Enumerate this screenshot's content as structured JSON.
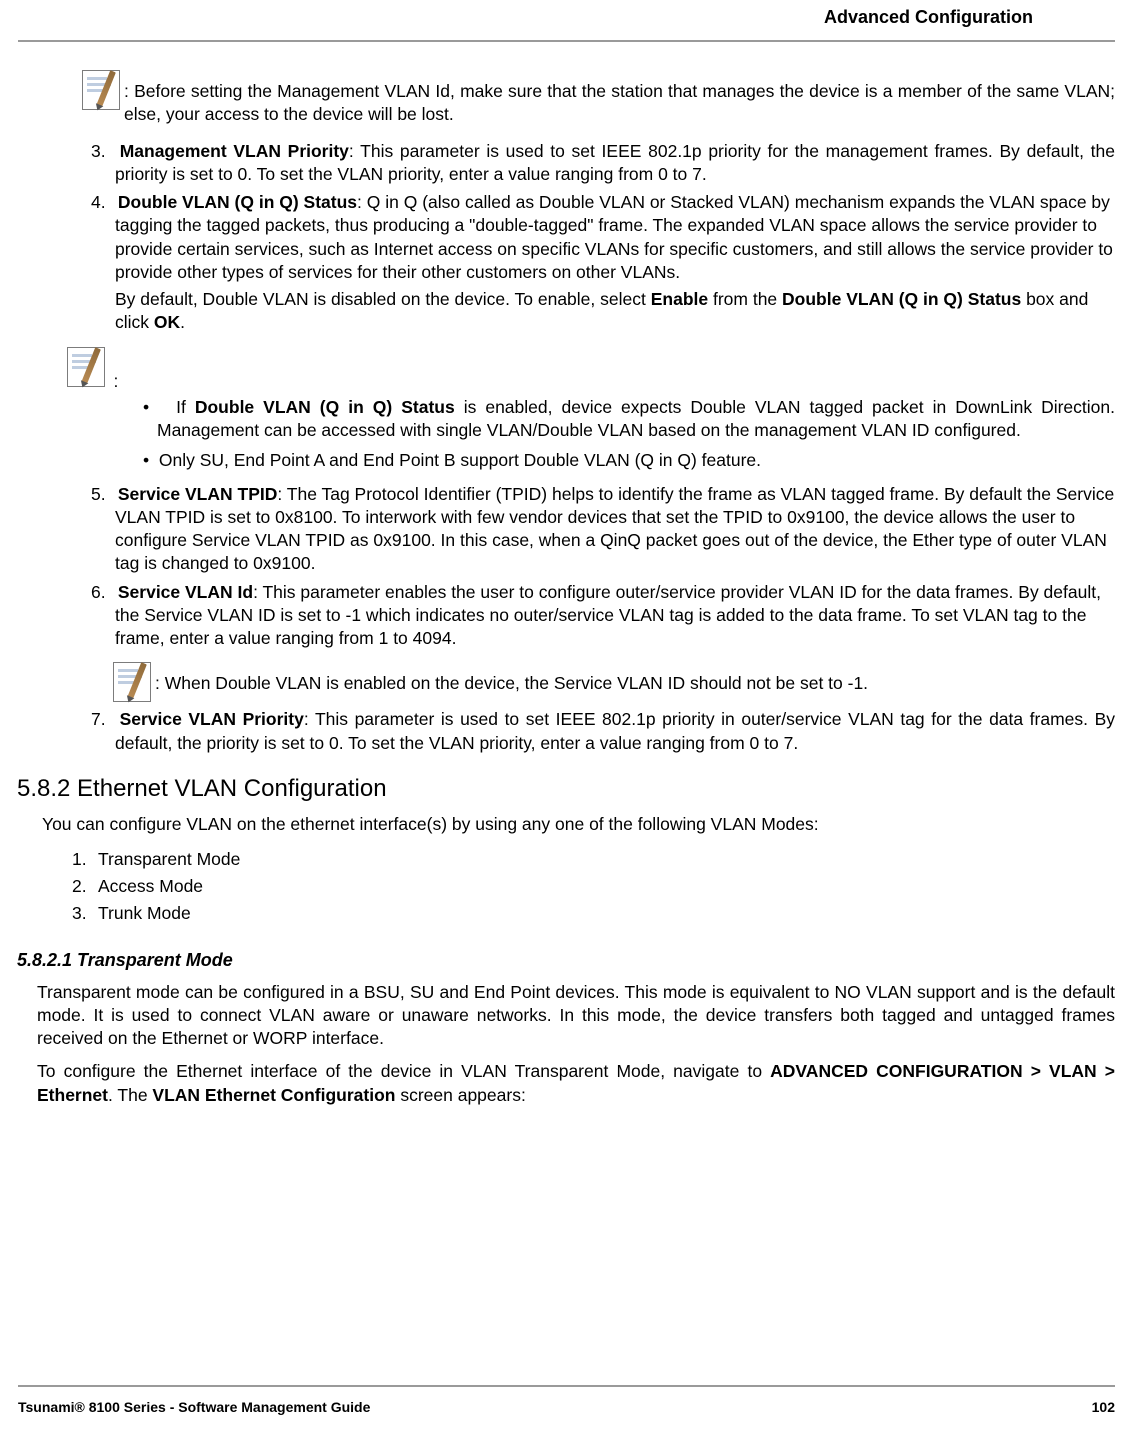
{
  "header": {
    "right": "Advanced Configuration"
  },
  "footer": {
    "left": "Tsunami® 8100 Series - Software Management Guide",
    "right": "102"
  },
  "note1": ": Before setting the Management VLAN Id, make sure that the station that manages the device is a member of the same VLAN; else, your access to the device will be lost.",
  "items": {
    "i3": {
      "num": "3.",
      "label": "Management VLAN Priority",
      "text": ": This parameter is used to set IEEE 802.1p priority for the management frames. By default, the priority is set to 0. To set the VLAN priority, enter a value ranging from 0 to 7."
    },
    "i4": {
      "num": "4.",
      "label": "Double VLAN (Q in Q) Status",
      "text": ": Q in Q (also called as Double VLAN or Stacked VLAN) mechanism expands the VLAN space by tagging the tagged packets, thus producing a \"double-tagged\" frame. The expanded VLAN space allows the service provider to provide certain services, such as Internet access on specific VLANs for specific customers, and still allows the service provider to provide other types of services for their other customers on other VLANs.",
      "cont_pre": "By default, Double VLAN is disabled on the device. To enable, select ",
      "cont_b1": "Enable",
      "cont_mid": " from the ",
      "cont_b2": "Double VLAN (Q in Q) Status",
      "cont_mid2": " box and click ",
      "cont_b3": "OK",
      "cont_post": "."
    },
    "i5": {
      "num": "5.",
      "label": "Service VLAN TPID",
      "text": ": The Tag Protocol Identifier (TPID) helps to identify the frame as VLAN tagged frame. By default the Service VLAN TPID is set to 0x8100. To interwork with few vendor devices that set the TPID to 0x9100, the device allows the user to configure Service VLAN TPID as 0x9100. In this case, when a QinQ packet goes out of the device, the Ether type of outer VLAN tag is changed to 0x9100."
    },
    "i6": {
      "num": "6.",
      "label": "Service VLAN Id",
      "text": ": This parameter enables the user to configure outer/service provider VLAN ID for the data frames. By default, the Service VLAN ID is set to -1 which indicates no outer/service VLAN tag is added to the data frame. To set VLAN tag to the frame, enter a value ranging from 1 to 4094."
    },
    "i7": {
      "num": "7.",
      "label": "Service VLAN Priority",
      "text": ": This parameter is used to set IEEE 802.1p priority in outer/service VLAN tag for the data frames. By default, the priority is set to 0. To set the VLAN priority, enter a value ranging from 0 to 7."
    }
  },
  "note2_colon": ":",
  "bullets": {
    "b1_pre": "If ",
    "b1_bold": "Double VLAN (Q in Q) Status",
    "b1_post": " is enabled, device expects Double VLAN tagged packet in DownLink Direction. Management can be accessed with single VLAN/Double VLAN based on the management VLAN ID configured.",
    "b2": "Only SU, End Point A and End Point B support Double VLAN (Q in Q) feature."
  },
  "note3": ": When Double VLAN is enabled on the device, the Service VLAN ID should not be set to -1.",
  "h2": "5.8.2 Ethernet VLAN Configuration",
  "h2_para": "You can configure VLAN on the ethernet interface(s) by using any one of the following VLAN Modes:",
  "modes": {
    "m1n": "1.",
    "m1": "Transparent Mode",
    "m2n": "2.",
    "m2": "Access Mode",
    "m3n": "3.",
    "m3": "Trunk Mode"
  },
  "h3": "5.8.2.1 Transparent Mode",
  "tp": {
    "p1": "Transparent mode can be configured in a BSU, SU and End Point devices. This mode is equivalent to NO VLAN support and is the default mode. It is used to connect VLAN aware or unaware networks. In this mode, the device transfers both tagged and untagged frames received on the Ethernet or WORP interface.",
    "p2_pre": "To configure the Ethernet interface of the device in VLAN Transparent Mode, navigate to ",
    "p2_b1": "ADVANCED CONFIGURATION > VLAN > Ethernet",
    "p2_mid": ". The ",
    "p2_b2": "VLAN Ethernet Configuration",
    "p2_post": " screen appears:"
  }
}
